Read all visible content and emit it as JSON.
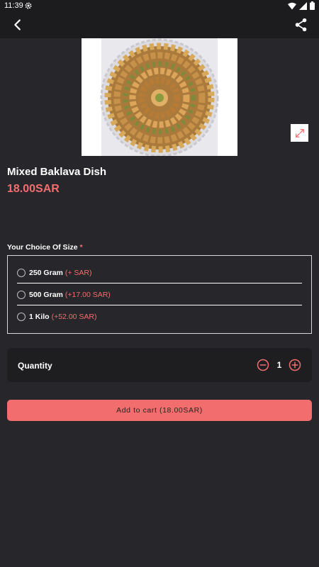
{
  "status_bar": {
    "time": "11:39",
    "icons": [
      "gear-icon",
      "wifi-icon",
      "signal-icon",
      "battery-icon"
    ]
  },
  "app_bar": {
    "back_icon": "chevron-left-icon",
    "share_icon": "share-icon"
  },
  "product": {
    "name": "Mixed Baklava Dish",
    "price": "18.00SAR",
    "image": "baklava-tray",
    "expand_icon": "expand-icon"
  },
  "size_section": {
    "title": "Your Choice Of Size",
    "required_mark": "*",
    "options": [
      {
        "label": "250 Gram",
        "extra": "(+ SAR)",
        "selected": false
      },
      {
        "label": "500 Gram",
        "extra": "(+17.00 SAR)",
        "selected": false
      },
      {
        "label": "1 Kilo",
        "extra": "(+52.00 SAR)",
        "selected": false
      }
    ]
  },
  "quantity": {
    "label": "Quantity",
    "value": "1",
    "minus_icon": "minus-circle-icon",
    "plus_icon": "plus-circle-icon"
  },
  "cart_button": {
    "label": "Add to cart (18.00SAR)"
  },
  "colors": {
    "background": "#27272b",
    "bar": "#1c1c1f",
    "accent": "#f26d6d",
    "text": "#ffffff"
  }
}
